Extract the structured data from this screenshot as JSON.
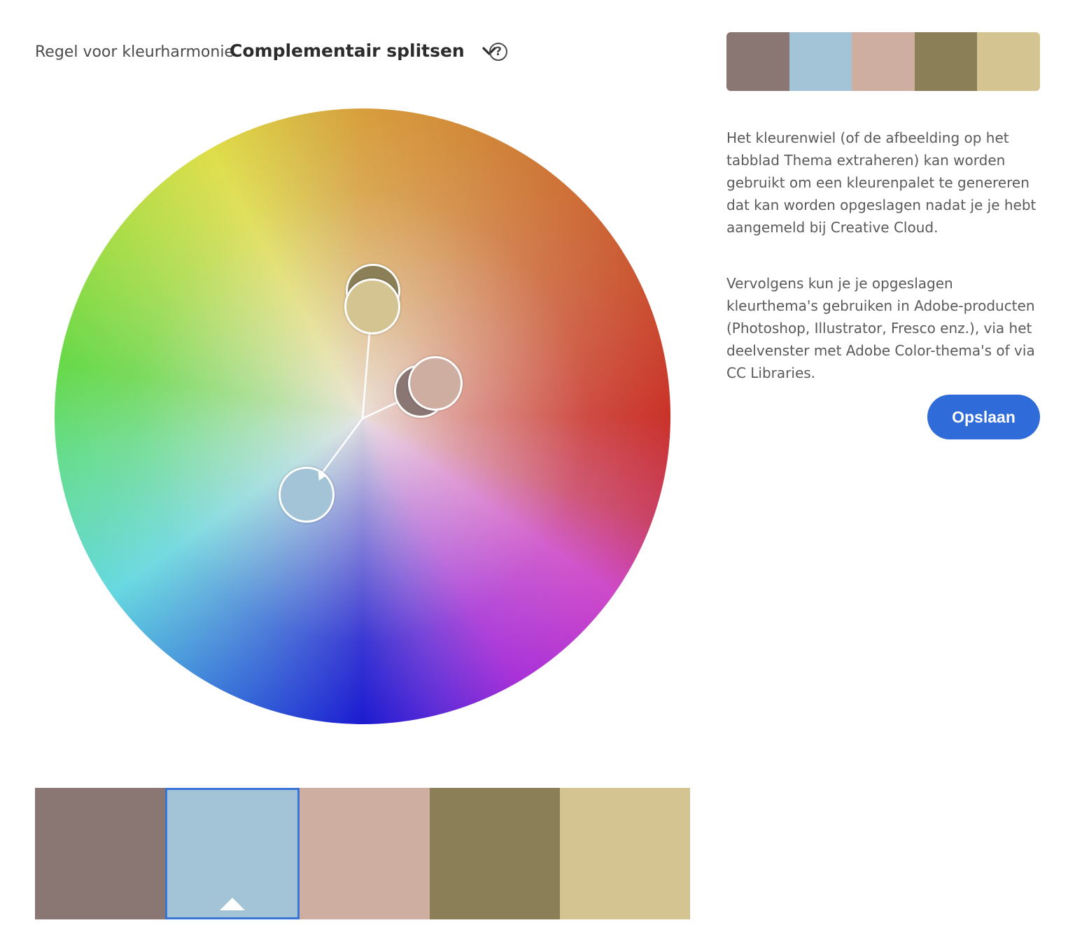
{
  "harmony": {
    "label": "Regel voor kleurharmonie",
    "selected_rule": "Complementair splitsen",
    "help_symbol": "?"
  },
  "palette": {
    "colors": [
      "#8a7672",
      "#a3c4d6",
      "#cfaea2",
      "#8b7f58",
      "#d3c491"
    ],
    "selected_index": 1
  },
  "description": {
    "paragraph1": "Het kleurenwiel (of de afbeelding op het tabblad Thema extraheren) kan worden gebruikt om een kleurenpalet te genereren dat kan worden opgeslagen nadat je je hebt aangemeld bij Creative Cloud.",
    "paragraph2": "Vervolgens kun je je opgeslagen kleurthema's gebruiken in Adobe-producten (Photoshop, Illustrator, Fresco enz.), via het deelvenster met Adobe Color-thema's of via CC Libraries."
  },
  "actions": {
    "save_label": "Opslaan"
  },
  "icons": {
    "dropdown": "chevron-down-icon",
    "help": "help-icon"
  }
}
